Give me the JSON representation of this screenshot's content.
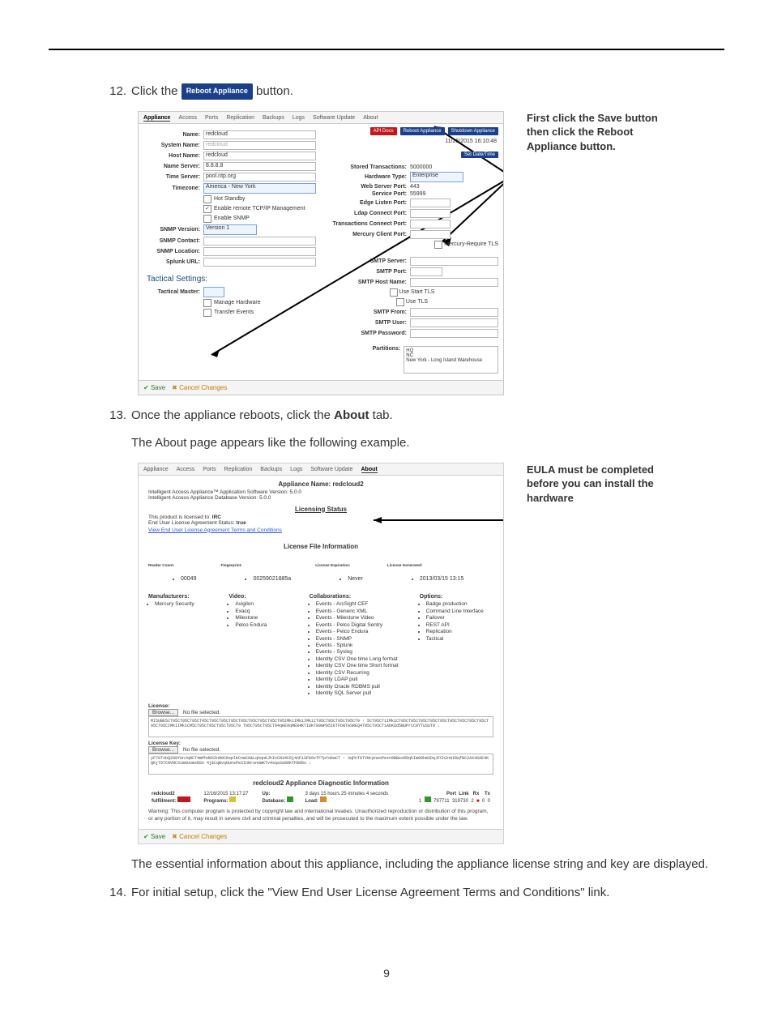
{
  "steps": {
    "s12a": "12.",
    "s12b_pre": "Click the ",
    "s12b_btn": "Reboot Appliance",
    "s12b_post": " button.",
    "s13a": "13.",
    "s13b": "Once the appliance reboots, click the ",
    "s13c": "About",
    "s13d": " tab.",
    "body1": "The About page appears like the following example.",
    "body2": "The essential information about this appliance, including the appliance license string and key are displayed.",
    "s14a": "14.",
    "s14b": "For initial setup, click the \"View End User License Agreement Terms and Conditions\" link."
  },
  "callout1": "First click the Save button then click the Reboot Appliance button.",
  "callout2": "EULA must be completed before you can install the hardware",
  "shot1": {
    "tabs": [
      "Appliance",
      "Access",
      "Ports",
      "Replication",
      "Backups",
      "Logs",
      "Software Update",
      "About"
    ],
    "topbtns": {
      "api": "API Docs",
      "reboot": "Reboot Appliance",
      "shutdown": "Shutdown Appliance"
    },
    "datetime": "11/25/2015 16:10:48",
    "setdatetime": "Set Date/Time",
    "left": {
      "Name": "redcloud",
      "System Name": "redcloud",
      "Host Name": "redcloud",
      "Name Server": "8.8.8.8",
      "Time Server": "pool.ntp.org",
      "Timezone": "America - New York",
      "cb": {
        "hot": "Hot Standby",
        "tcp": "Enable remote TCP/IP Management",
        "snmp": "Enable SNMP"
      },
      "SNMP Version": "Version 1",
      "SNMP Contact": "",
      "SNMP Location": "",
      "Splunk URL": ""
    },
    "tactical_h": "Tactical Settings:",
    "tactical": {
      "Tactical Master": "",
      "cb": {
        "mh": "Manage Hardware",
        "te": "Transfer Events"
      }
    },
    "right": {
      "Stored Transactions": "5000000",
      "Hardware Type": "Enterprise",
      "Web Server Port": "443",
      "Service Port": "55999",
      "Edge Listen Port": "",
      "Ldap Connect Port": "",
      "Transactions Connect Port": "",
      "Mercury Client Port": "",
      "mreq": "Mercury-Require TLS",
      "SMTP Server": "",
      "SMTP Port": "",
      "SMTP Host Name": "",
      "starttls": "Use Start TLS",
      "usetls": "Use TLS",
      "SMTP From": "",
      "SMTP User": "",
      "SMTP Password": "",
      "Partitions": "Partitions:",
      "partlist": [
        "HQ",
        "NC",
        "New York - Long Island Warehouse"
      ]
    },
    "save": "Save",
    "cancel": "Cancel Changes"
  },
  "shot2": {
    "tabs": [
      "Appliance",
      "Access",
      "Ports",
      "Replication",
      "Backups",
      "Logs",
      "Software Update",
      "About"
    ],
    "apname_label": "Appliance Name: ",
    "apname": "redcloud2",
    "line1": "Intelligent Access Appliance™ Application Software Version: 5.0.0",
    "line2": "Intelligent Access Appliance Database Version: 5.0.0",
    "lic_h": "Licensing Status",
    "lic_to": "This product is licensed to: IRC",
    "eula": "End User License Agreement Status: true",
    "eula_link": "View End User License Agreement Terms and Conditions",
    "lfi": "License File Information",
    "hdr": {
      "rc": "Reader Count:",
      "fp": "Fingerprint:",
      "le": "License Expiration:",
      "lg": "License Generated:"
    },
    "vals": {
      "rc": "00049",
      "fp": "00259021885a",
      "le": "Never",
      "lg": "2013/03/15 13:15"
    },
    "cols": {
      "mfr_h": "Manufacturers:",
      "mfr": [
        "Mercury Security"
      ],
      "vid_h": "Video:",
      "vid": [
        "Avigilon",
        "Exacq",
        "Milestone",
        "Pelco Endura"
      ],
      "col_h": "Collaborations:",
      "col": [
        "Events - ArcSight CEF",
        "Events - Generic XML",
        "Events - Milestone Video",
        "Events - Pelco Digital Sentry",
        "Events - Pelco Endura",
        "Events - SNMP",
        "Events - Splunk",
        "Events - Syslog",
        "Identity CSV One time Long format",
        "Identity CSV One time Short format",
        "Identity CSV Recurring",
        "Identity LDAP pull",
        "Identity Oracle RDBMS pull",
        "Identity SQL Server pull"
      ],
      "opt_h": "Options:",
      "opt": [
        "Badge production",
        "Command Line Interface",
        "Failover",
        "REST API",
        "Replication",
        "Tactical"
      ]
    },
    "licL": "License:",
    "browse": "Browse...",
    "nofile": "No file selected.",
    "licstr": "MI5UBE5CT95CT95CT95CT95CT95CT95CT95CT95CT95CT95CT95CT95IMk1IMk1IMk1IT95CT95CT95CT95CT9 ↑\n5CT95CT1IMk1CT95CT95CT95CT95CT95CT95CT95CT95CT95CT95CT95CIMk1IMk1CM5CT95CT95CT95CT95CT9\nT95CT95CT95CT94qKE9qME84KT18KT89mP05IKTFbNTASREQ4T95CT95CT1AbKUd5BUPrCC0YTUSUT9 ↓",
    "keyL": "License Key:",
    "keystr": "yF76TxbQ280YUnJqNCT4mPhd0XZnN9CKeplKCnwC0&LqhqnKJhInCN34C0j4nF1SFb0vTFTpYoKwCT ↑\n3qPnT0TVNcpneoPexn9BBexR0qhIm00hmSDqJFCh2nHIRqfBC2AX46AE4KQKjT07CNVNC3imAUomsNSn\n4j&CqBvqGUnsPe3InNrsnUmKTv4sqa3a90KTFBd0s ↓",
    "diag_h": "redcloud2 Appliance Diagnostic Information",
    "r1": {
      "host": "redcloud2",
      "ts": "12/16/2015 13:17:27",
      "up_l": "Up:",
      "up": "3 days 15 hours 25 minutes 4 seconds"
    },
    "r2": {
      "mm": "fulfillment:",
      "prog": "Programs:",
      "db": "Database:",
      "load": "Load:"
    },
    "nethdr": {
      "port": "Port",
      "link": "Link",
      "rx": "Rx",
      "tx": "Tx"
    },
    "net": {
      "port": "1",
      "link": "",
      "rx": "797711",
      "tx": "319730",
      "c1": "2",
      "c2": "0",
      "c3": "0"
    },
    "warn": "Warning: This computer program is protected by copyright law and international treaties. Unauthorized reproduction or distribution of this program, or any portion of it, may result in severe civil and criminal penalties, and will be prosecuted to the maximum extent possible under the law.",
    "save": "Save",
    "cancel": "Cancel Changes"
  },
  "pgnum": "9"
}
